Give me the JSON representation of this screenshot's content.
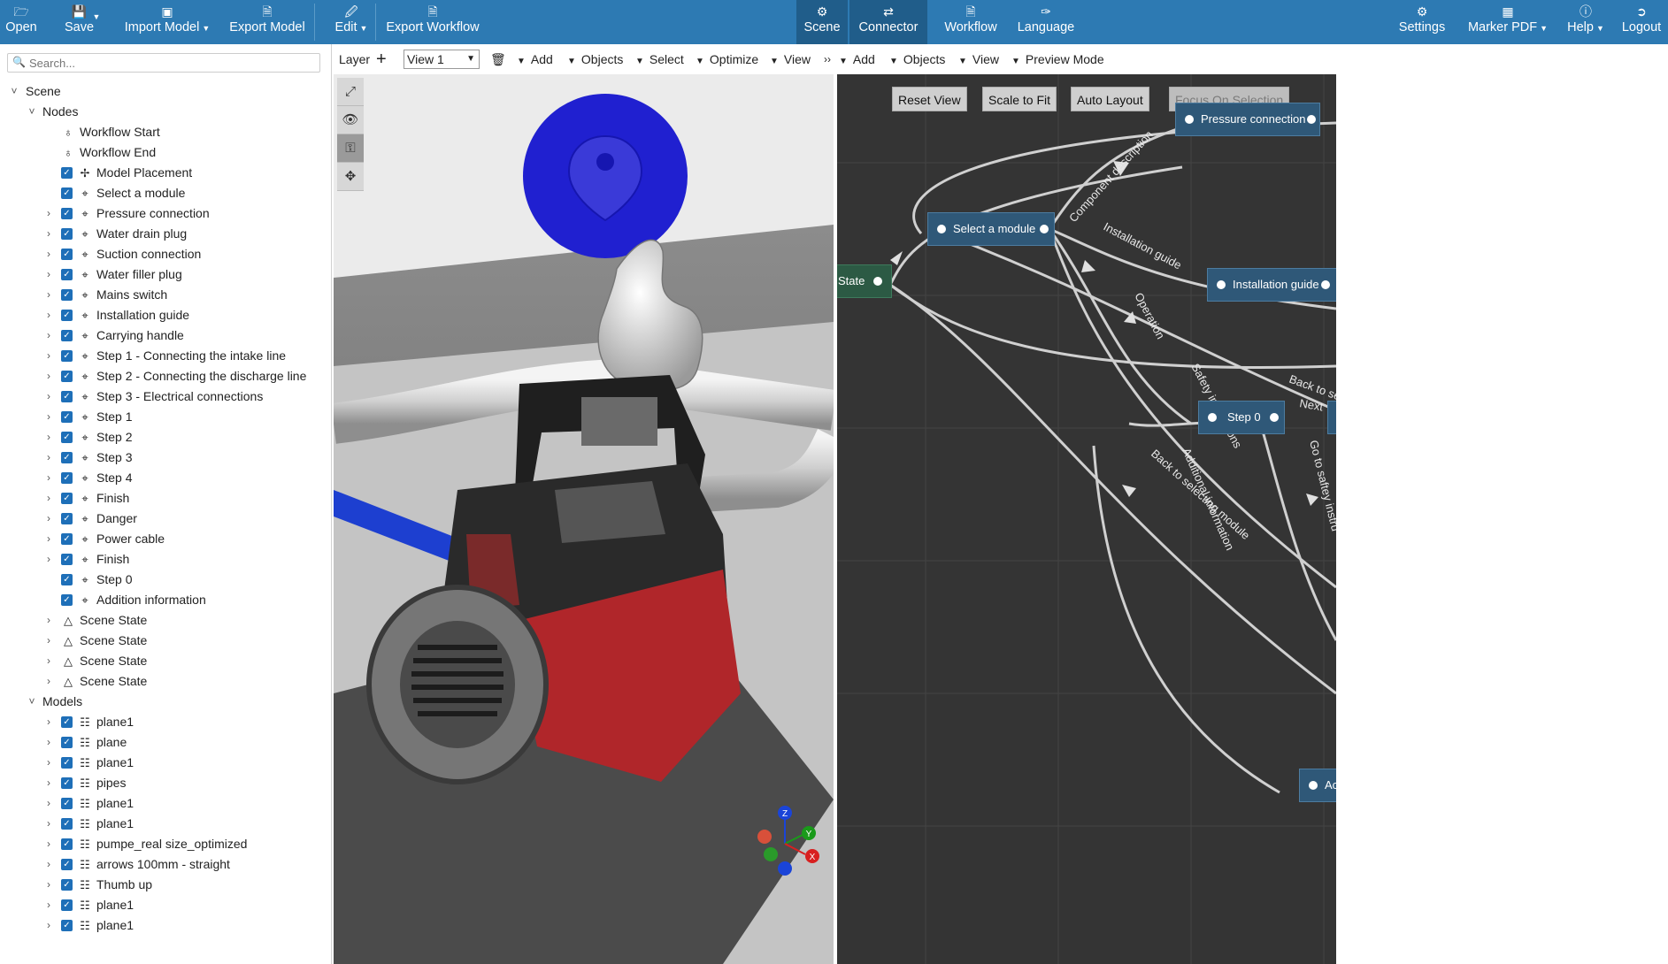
{
  "toolbar": {
    "open": "Open",
    "save": "Save",
    "import_model": "Import Model",
    "export_model": "Export Model",
    "edit": "Edit",
    "export_workflow": "Export Workflow",
    "scene": "Scene",
    "connector": "Connector",
    "workflow": "Workflow",
    "language": "Language",
    "settings": "Settings",
    "marker_pdf": "Marker PDF",
    "help": "Help",
    "logout": "Logout",
    "active_tab": "Scene"
  },
  "search": {
    "placeholder": "Search..."
  },
  "tree": {
    "scene": "Scene",
    "nodes": "Nodes",
    "workflow_start": "Workflow Start",
    "workflow_end": "Workflow End",
    "node_items": [
      "Model Placement",
      "Select a module",
      "Pressure connection",
      "Water drain plug",
      "Suction connection",
      "Water filler plug",
      "Mains switch",
      "Installation guide",
      "Carrying handle",
      "Step 1 - Connecting the intake line",
      "Step 2 - Connecting the discharge line",
      "Step 3 - Electrical connections",
      "Step 1",
      "Step 2",
      "Step 3",
      "Step 4",
      "Finish",
      "Danger",
      "Power cable",
      "Finish",
      "Step 0",
      "Addition information"
    ],
    "scene_states": [
      "Scene State",
      "Scene State",
      "Scene State",
      "Scene State"
    ],
    "models": "Models",
    "model_items": [
      "plane1",
      "plane",
      "plane1",
      "pipes",
      "plane1",
      "plane1",
      "pumpe_real size_optimized",
      "arrows 100mm - straight",
      "Thumb up",
      "plane1",
      "plane1"
    ]
  },
  "viewport_toolbar": {
    "layer": "Layer",
    "view_value": "View 1",
    "left": {
      "add": "Add",
      "objects": "Objects",
      "select": "Select",
      "optimize": "Optimize",
      "view": "View"
    },
    "right": {
      "add": "Add",
      "objects": "Objects",
      "view": "View",
      "preview": "Preview Mode"
    }
  },
  "graph": {
    "buttons": {
      "reset": "Reset View",
      "scale": "Scale to Fit",
      "auto": "Auto Layout",
      "focus": "Focus On Selection"
    },
    "nodes": {
      "pressure": "Pressure connection",
      "select": "Select a module",
      "state": "State",
      "install": "Installation guide",
      "step0": "Step 0",
      "ad": "Ac"
    },
    "edge_labels": {
      "component_description": "Component description",
      "installation_guide": "Installation guide",
      "operation": "Operation",
      "safety_instructions": "Safety instructions",
      "back_to_se": "Back to se",
      "next": "Next",
      "go_to_safety": "Go to saftey instru",
      "additional_information": "Additional information",
      "back_to_selecting": "Back to selecting module"
    }
  },
  "axis": {
    "z": "Z",
    "y": "Y",
    "x": "X"
  },
  "colors": {
    "toolbar": "#2d7ab3",
    "graph_bg": "#343434",
    "node": "#2f5878",
    "marker": "#2020d0",
    "pump_red": "#b0262a"
  }
}
